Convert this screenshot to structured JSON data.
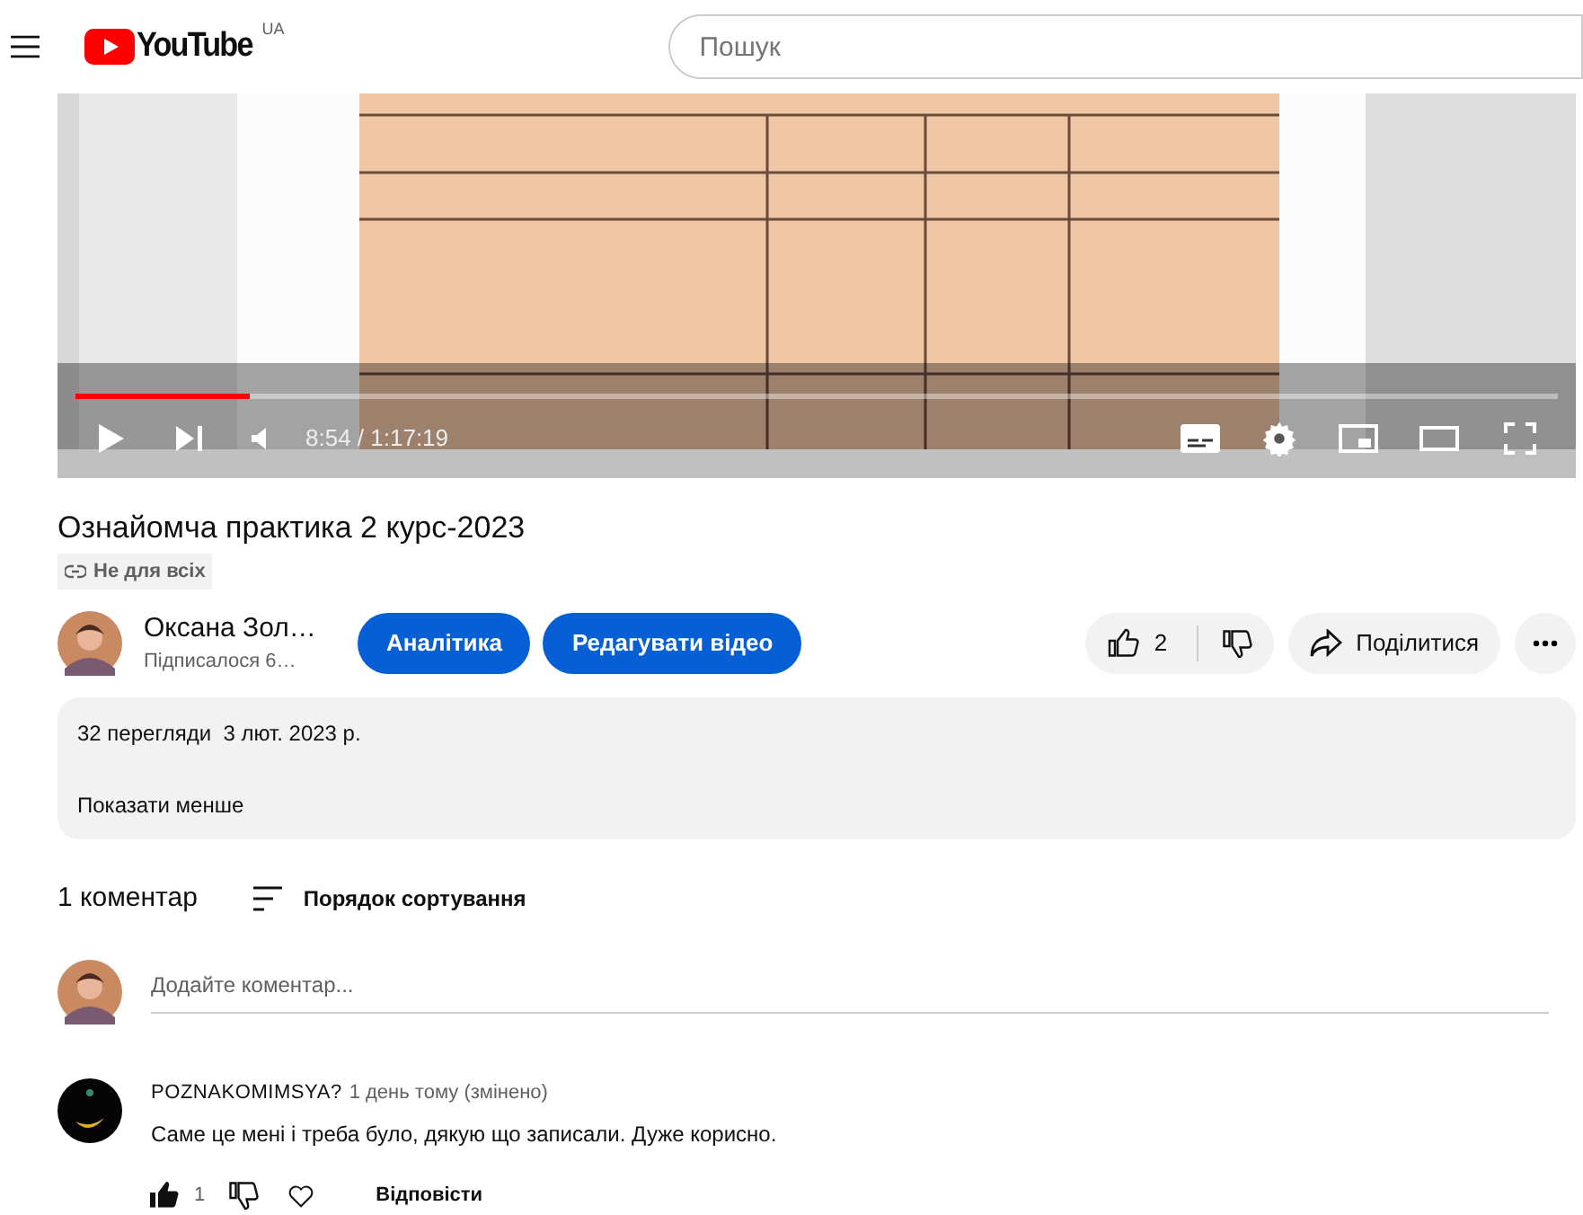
{
  "header": {
    "logo": "YouTube",
    "logo_region": "UA",
    "search": {
      "placeholder": "Пошук"
    }
  },
  "player": {
    "progress": {
      "level": 0.117
    },
    "time": "8:54 / 1:17:19"
  },
  "video": {
    "title": "Ознайомча практика 2 курс-2023",
    "visibility": "Не для всіх"
  },
  "channel": {
    "name": "Оксана Зол…",
    "subscribers": "Підписалося 6…"
  },
  "actions": {
    "buttons": [
      "Аналітика",
      "Редагувати відео"
    ],
    "likes": "2",
    "share": "Поділитися"
  },
  "description": {
    "stats": "32 перегляди  3 лют. 2023 р.",
    "toggle": "Показати менше"
  },
  "comments": {
    "count": "1 коментар",
    "sort": "Порядок сортування",
    "add": {
      "placeholder": "Додайте коментар..."
    },
    "items": [
      {
        "author": "POZNAKOMIMSYA?",
        "time": "1 день тому (змінено)",
        "text": "Саме це мені і треба було, дякую що записали. Дуже корисно.",
        "likes": "1",
        "liked": true,
        "reply": "Відповісти"
      }
    ]
  }
}
